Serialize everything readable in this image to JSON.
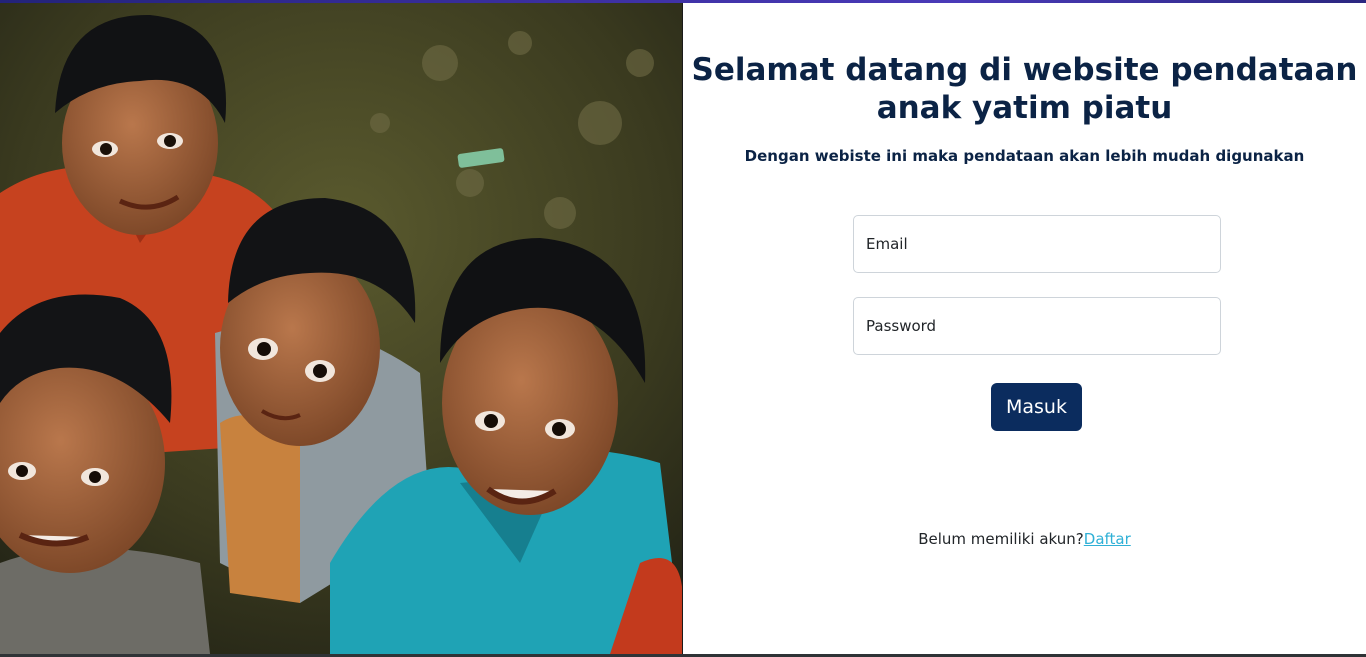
{
  "hero_image": {
    "subject": "four smiling children looking up at the camera"
  },
  "login": {
    "title": "Selamat datang di website pendataan anak yatim piatu",
    "subtitle": "Dengan webiste ini maka pendataan akan lebih mudah digunakan",
    "email_placeholder": "Email",
    "password_placeholder": "Password",
    "submit_label": "Masuk",
    "register_prompt": "Belum memiliki akun?",
    "register_link": "Daftar"
  },
  "colors": {
    "title": "#0b2345",
    "button": "#0b2c5e",
    "link": "#2fb0d6"
  }
}
